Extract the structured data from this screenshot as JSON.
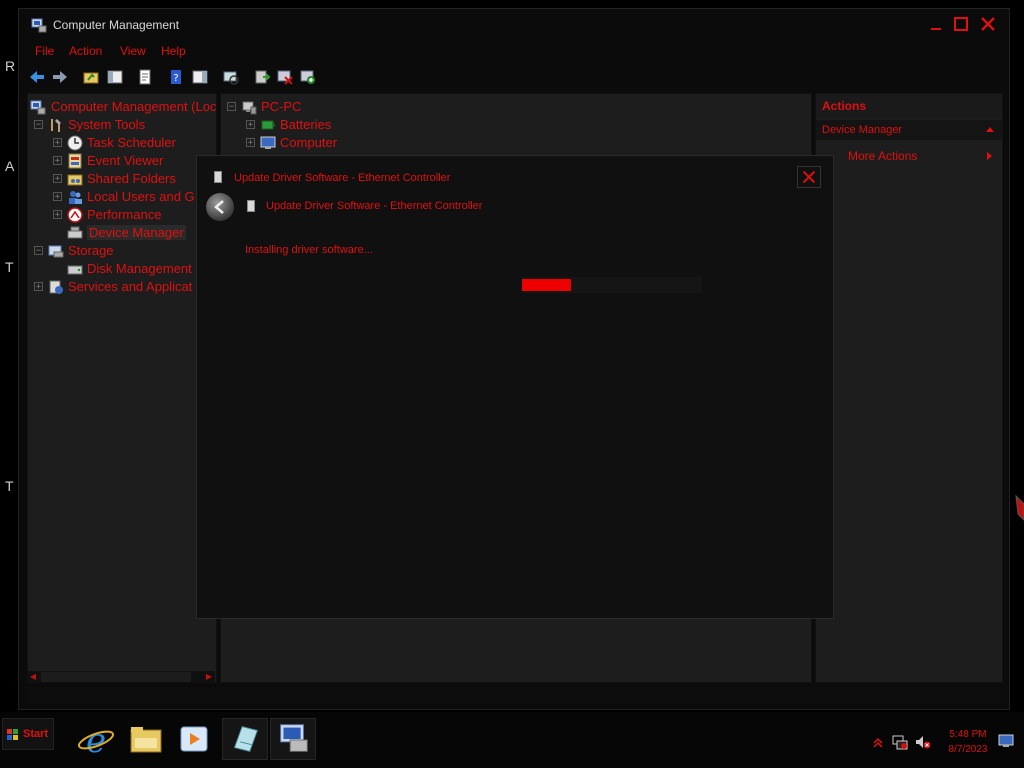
{
  "desktop": {
    "edge_letters": [
      "R",
      "A",
      "T",
      "T"
    ]
  },
  "window": {
    "title": "Computer Management",
    "menu": [
      "File",
      "Action",
      "View",
      "Help"
    ]
  },
  "tree": {
    "items": [
      {
        "label": "Computer Management (Loc",
        "expander": "",
        "icon": "computer-management-icon"
      },
      {
        "label": "System Tools",
        "expander": "−",
        "icon": "tools-icon"
      },
      {
        "label": "Task Scheduler",
        "expander": "+",
        "icon": "clock-icon"
      },
      {
        "label": "Event Viewer",
        "expander": "+",
        "icon": "event-viewer-icon"
      },
      {
        "label": "Shared Folders",
        "expander": "+",
        "icon": "shared-folder-icon"
      },
      {
        "label": "Local Users and G",
        "expander": "+",
        "icon": "users-icon"
      },
      {
        "label": "Performance",
        "expander": "+",
        "icon": "performance-icon"
      },
      {
        "label": "Device Manager",
        "expander": "",
        "icon": "device-manager-icon"
      },
      {
        "label": "Storage",
        "expander": "−",
        "icon": "storage-icon"
      },
      {
        "label": "Disk Management",
        "expander": "",
        "icon": "disk-icon"
      },
      {
        "label": "Services and Applicat",
        "expander": "+",
        "icon": "services-icon"
      }
    ]
  },
  "center": {
    "items": [
      {
        "label": "PC-PC",
        "expander": "−",
        "icon": "computer-icon"
      },
      {
        "label": "Batteries",
        "expander": "+",
        "icon": "battery-icon"
      },
      {
        "label": "Computer",
        "expander": "+",
        "icon": "monitor-icon"
      }
    ]
  },
  "actions": {
    "header": "Actions",
    "section": "Device Manager",
    "item": "More Actions"
  },
  "dialog": {
    "window_title": "Update Driver Software - Ethernet Controller",
    "header": "Update Driver Software - Ethernet Controller",
    "status": "Installing driver software...",
    "progress": 0.27
  },
  "taskbar": {
    "start_label": "Start",
    "apps": [
      "internet-explorer-icon",
      "file-explorer-icon",
      "media-player-icon",
      "notepad-icon",
      "computer-management-icon"
    ],
    "time": "5:48 PM",
    "date": "8/7/2023"
  },
  "colors": {
    "accent": "#e01010",
    "background": "#000000",
    "pane": "#1d1d1d"
  }
}
